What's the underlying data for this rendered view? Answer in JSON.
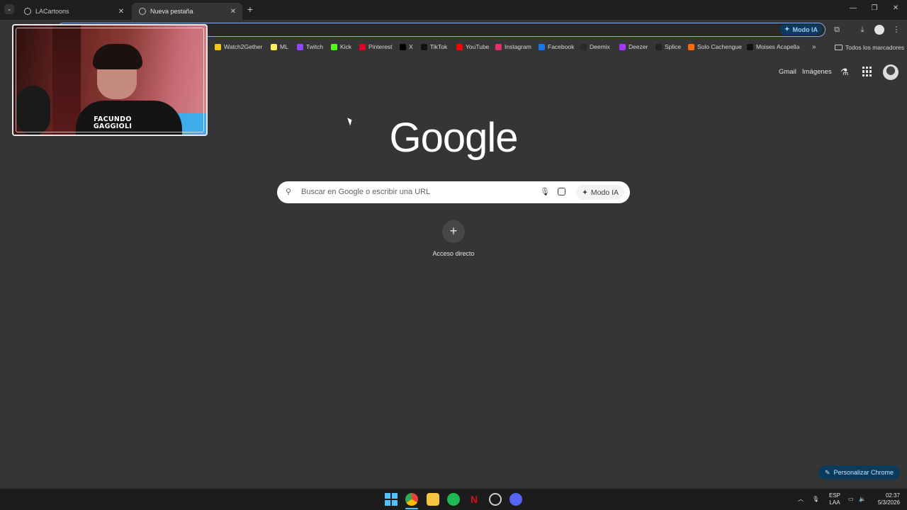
{
  "tabs": [
    {
      "title": "LACartoons",
      "active": false
    },
    {
      "title": "Nueva pestaña",
      "active": true
    }
  ],
  "omnibox": {
    "ai_mode_label": "Modo IA"
  },
  "bookmarks": [
    {
      "label": "Watch2Gether",
      "icon": "watch2gether-icon",
      "color": "#f5c518"
    },
    {
      "label": "ML",
      "icon": "mercadolibre-icon",
      "color": "#fff159"
    },
    {
      "label": "Twitch",
      "icon": "twitch-icon",
      "color": "#9146ff"
    },
    {
      "label": "Kick",
      "icon": "kick-icon",
      "color": "#53fc18"
    },
    {
      "label": "Pinterest",
      "icon": "pinterest-icon",
      "color": "#e60023"
    },
    {
      "label": "X",
      "icon": "x-icon",
      "color": "#000000"
    },
    {
      "label": "TikTok",
      "icon": "tiktok-icon",
      "color": "#111111"
    },
    {
      "label": "YouTube",
      "icon": "youtube-icon",
      "color": "#ff0000"
    },
    {
      "label": "Instagram",
      "icon": "instagram-icon",
      "color": "#e1306c"
    },
    {
      "label": "Facebook",
      "icon": "facebook-icon",
      "color": "#1877f2"
    },
    {
      "label": "Deemix",
      "icon": "deemix-icon",
      "color": "#2a2a2a"
    },
    {
      "label": "Deezer",
      "icon": "deezer-icon",
      "color": "#a238ff"
    },
    {
      "label": "Splice",
      "icon": "splice-icon",
      "color": "#222222"
    },
    {
      "label": "Solo Cachengue",
      "icon": "fire-icon",
      "color": "#ff6a00"
    },
    {
      "label": "Moises Acapella",
      "icon": "moises-icon",
      "color": "#111111"
    }
  ],
  "bookmarks_all_label": "Todos los marcadores",
  "webcam": {
    "name_line1": "FACUNDO",
    "name_line2": "GAGGIOLI"
  },
  "top_links": {
    "gmail": "Gmail",
    "images": "Imágenes"
  },
  "logo_text": "Google",
  "search": {
    "placeholder": "Buscar en Google o escribir una URL",
    "ai_mode_label": "Modo IA"
  },
  "shortcut": {
    "label": "Acceso directo",
    "plus": "+"
  },
  "customize_label": "Personalizar Chrome",
  "tray": {
    "lang1": "ESP",
    "lang2": "LAA",
    "time": "02:37",
    "date": "5/3/2026"
  },
  "colors": {
    "accent": "#7cacf8",
    "customize_bg": "#0b3a5c",
    "page_bg": "#353535"
  }
}
